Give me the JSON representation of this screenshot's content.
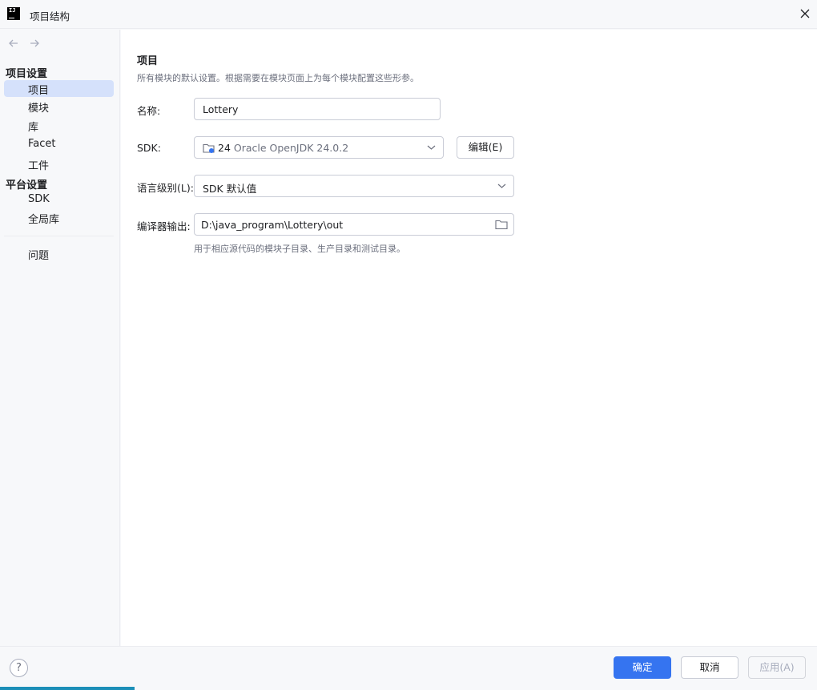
{
  "window": {
    "title": "项目结构"
  },
  "sidebar": {
    "project_settings_heading": "项目设置",
    "project_items": [
      {
        "label": "项目",
        "selected": true
      },
      {
        "label": "模块",
        "selected": false
      },
      {
        "label": "库",
        "selected": false
      },
      {
        "label": "Facet",
        "selected": false
      },
      {
        "label": "工件",
        "selected": false
      }
    ],
    "platform_settings_heading": "平台设置",
    "platform_items": [
      {
        "label": "SDK"
      },
      {
        "label": "全局库"
      }
    ],
    "problems_label": "问题"
  },
  "main": {
    "title": "项目",
    "description": "所有模块的默认设置。根据需要在模块页面上为每个模块配置这些形参。",
    "name_label": "名称:",
    "name_value": "Lottery",
    "sdk_label": "SDK:",
    "sdk_version": "24",
    "sdk_name": "Oracle OpenJDK 24.0.2",
    "sdk_edit_label": "编辑(E)",
    "language_level_label": "语言级别(L):",
    "language_level_value": "SDK 默认值",
    "compiler_output_label": "编译器输出:",
    "compiler_output_value": "D:\\java_program\\Lottery\\out",
    "compiler_output_hint": "用于相应源代码的模块子目录、生产目录和测试目录。"
  },
  "footer": {
    "help_label": "?",
    "ok_label": "确定",
    "cancel_label": "取消",
    "apply_label": "应用(A)",
    "apply_enabled": false
  },
  "colors": {
    "accent": "#3574f0",
    "selection": "#d5e1fb",
    "sidebar_bg": "#f7f8fa",
    "content_bg": "#ffffff"
  }
}
